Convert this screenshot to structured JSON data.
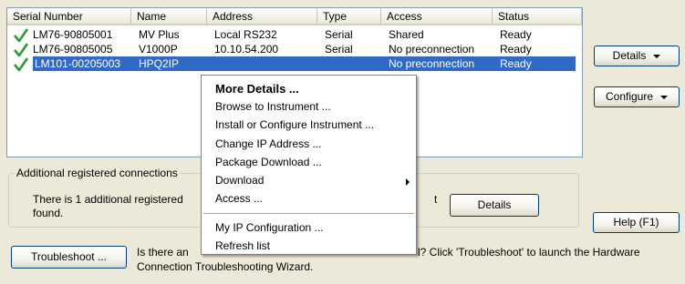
{
  "listview": {
    "columns": [
      "Serial Number",
      "Name",
      "Address",
      "Type",
      "Access",
      "Status"
    ],
    "rows": [
      {
        "serial": "LM76-90805001",
        "name": "MV Plus",
        "address": "Local RS232",
        "type": "Serial",
        "access": "Shared",
        "status": "Ready"
      },
      {
        "serial": "LM76-90805005",
        "name": "V1000P",
        "address": "10.10.54.200",
        "type": "Serial",
        "access": "No preconnection",
        "status": "Ready"
      },
      {
        "serial": "LM101-00205003",
        "name": "HPQ2IP",
        "address": "",
        "type": "",
        "access": "No preconnection",
        "status": "Ready"
      }
    ]
  },
  "buttons": {
    "details_menu": "Details",
    "configure_menu": "Configure",
    "details": "Details",
    "help": "Help (F1)",
    "troubleshoot": "Troubleshoot ..."
  },
  "group": {
    "title": "Additional registered connections",
    "line1": "There is 1 additional registered",
    "line1_tail": "t",
    "line2": "found."
  },
  "troubleshoot_text": {
    "line1_start": "Is there an",
    "line1_end": "l? Click 'Troubleshoot' to launch the Hardware",
    "line2": "Connection Troubleshooting Wizard."
  },
  "context_menu": {
    "items": [
      "More Details ...",
      "Browse to Instrument ...",
      "Install or Configure Instrument ...",
      "Change IP Address ...",
      "Package Download ...",
      "Download",
      "Access ...",
      "My IP Configuration ...",
      "Refresh list"
    ]
  },
  "colors": {
    "selection": "#316ac5",
    "check": "#2e9b2e",
    "dialog_bg": "#ece9d8"
  }
}
